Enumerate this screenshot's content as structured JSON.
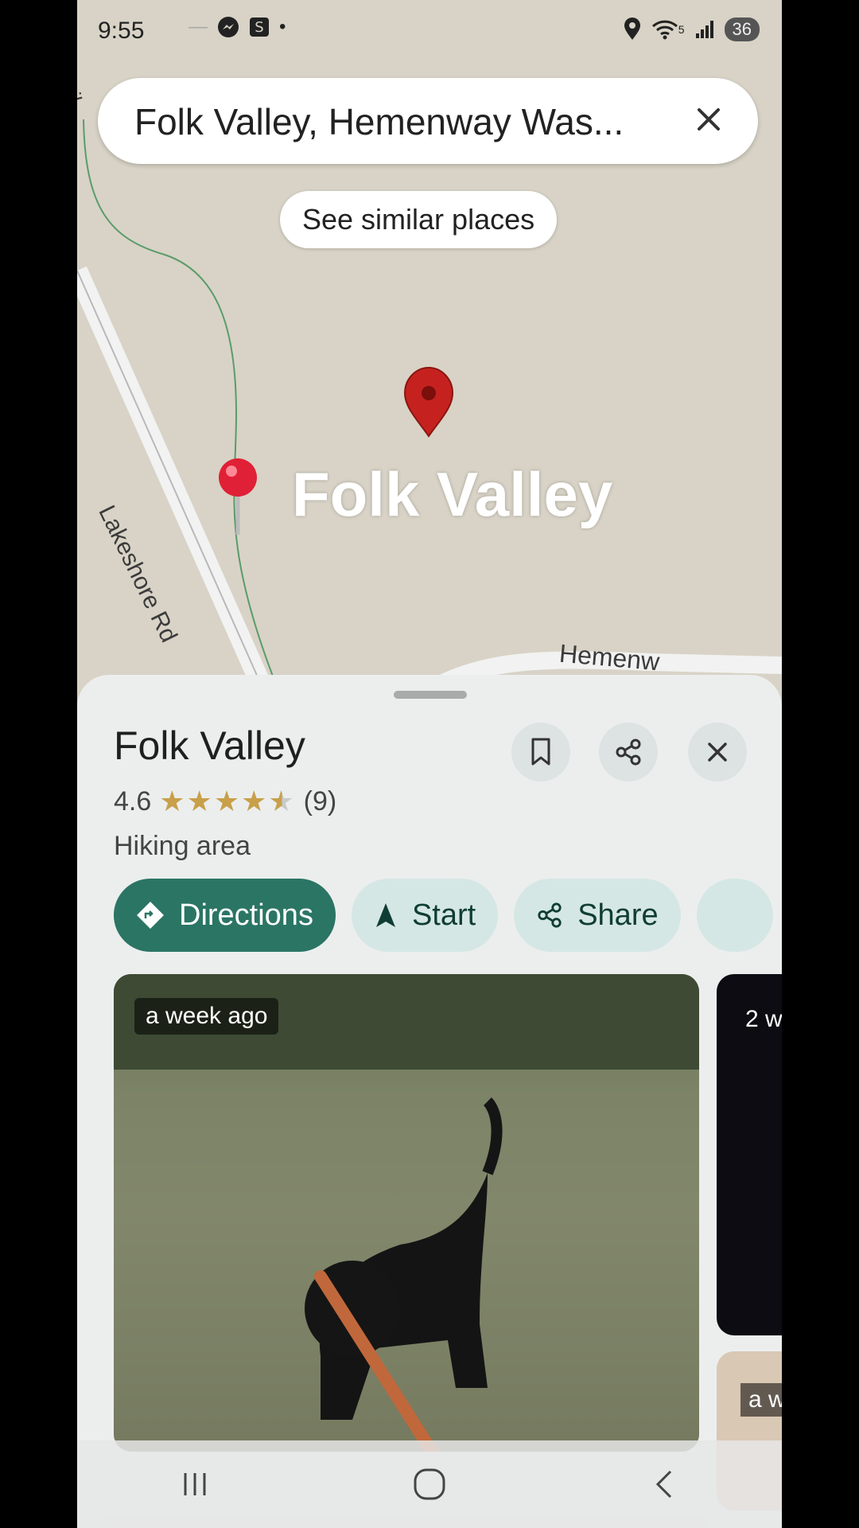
{
  "status_bar": {
    "time": "9:55",
    "left_icons": [
      "minimize-dash-icon",
      "messenger-icon",
      "s-app-icon",
      "dot-icon"
    ],
    "right_icons": [
      "location-icon",
      "wifi-icon",
      "signal-icon"
    ],
    "wifi_badge": "5",
    "battery": "36"
  },
  "search": {
    "query": "Folk Valley, Hemenway Was..."
  },
  "map": {
    "similar_places_label": "See similar places",
    "place_label": "Folk Valley",
    "road_label": "Lakeshore Rd",
    "trail_label": "Trail",
    "road2_label": "Hemenw",
    "pin_color": "#c5221f"
  },
  "place": {
    "title": "Folk Valley",
    "rating": "4.6",
    "stars": "★★★★",
    "half_star": "★",
    "empty_star": "★",
    "reviews": "(9)",
    "category": "Hiking area",
    "actions": {
      "directions": "Directions",
      "start": "Start",
      "share": "Share"
    },
    "photos": [
      {
        "age": "a week ago"
      },
      {
        "age": "2 w"
      },
      {
        "age": "a w"
      }
    ]
  },
  "colors": {
    "primary": "#2b7565",
    "secondary_chip": "#d5e7e4",
    "star": "#c8a04a"
  }
}
